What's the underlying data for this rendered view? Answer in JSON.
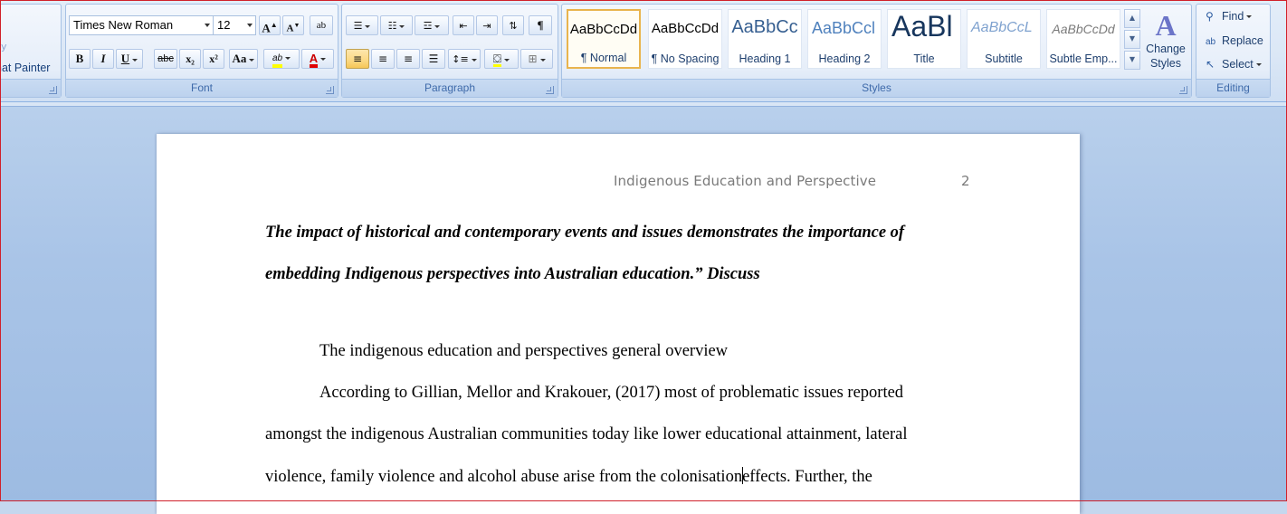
{
  "ribbon": {
    "clipboard": {
      "format_painter": "nat Painter"
    },
    "font": {
      "label": "Font",
      "font_name": "Times New Roman",
      "font_size": "12",
      "grow_font": "A",
      "shrink_font": "A",
      "clear_format": "ab",
      "bold": "B",
      "italic": "I",
      "underline": "U",
      "strikethrough": "abc",
      "subscript": "x₂",
      "superscript": "x²",
      "change_case": "Aa",
      "highlight": "ab",
      "font_color": "A",
      "highlight_color": "#ffff00",
      "font_color_value": "#e00000"
    },
    "paragraph": {
      "label": "Paragraph",
      "show_marks": "¶"
    },
    "styles": {
      "label": "Styles",
      "tiles": [
        {
          "sample": "AaBbCcDd",
          "name": "¶ Normal",
          "active": true
        },
        {
          "sample": "AaBbCcDd",
          "name": "¶ No Spacing"
        },
        {
          "sample": "AaBbCc",
          "name": "Heading 1"
        },
        {
          "sample": "AaBbCcl",
          "name": "Heading 2"
        },
        {
          "sample": "AaBl",
          "name": "Title"
        },
        {
          "sample": "AaBbCcL",
          "name": "Subtitle"
        },
        {
          "sample": "AaBbCcDd",
          "name": "Subtle Emp..."
        }
      ],
      "change_styles": "Change Styles"
    },
    "editing": {
      "label": "Editing",
      "find": "Find",
      "replace": "Replace",
      "select": "Select"
    }
  },
  "document": {
    "header_title": "Indigenous Education and Perspective",
    "header_page": "2",
    "title_line_1": "The impact of historical and contemporary events and issues demonstrates the importance of",
    "title_line_2": "embedding Indigenous perspectives into Australian education.” Discuss",
    "section_heading": "The indigenous education and perspectives general overview",
    "body_line_1": "According to Gillian, Mellor and Krakouer, (2017) most of problematic issues reported",
    "body_line_2": "amongst the indigenous Australian communities today like lower educational attainment, lateral",
    "body_line_3a": "violence, family violence and alcohol abuse arise from the colonisation",
    "body_line_3b": "effects. Further, the"
  }
}
